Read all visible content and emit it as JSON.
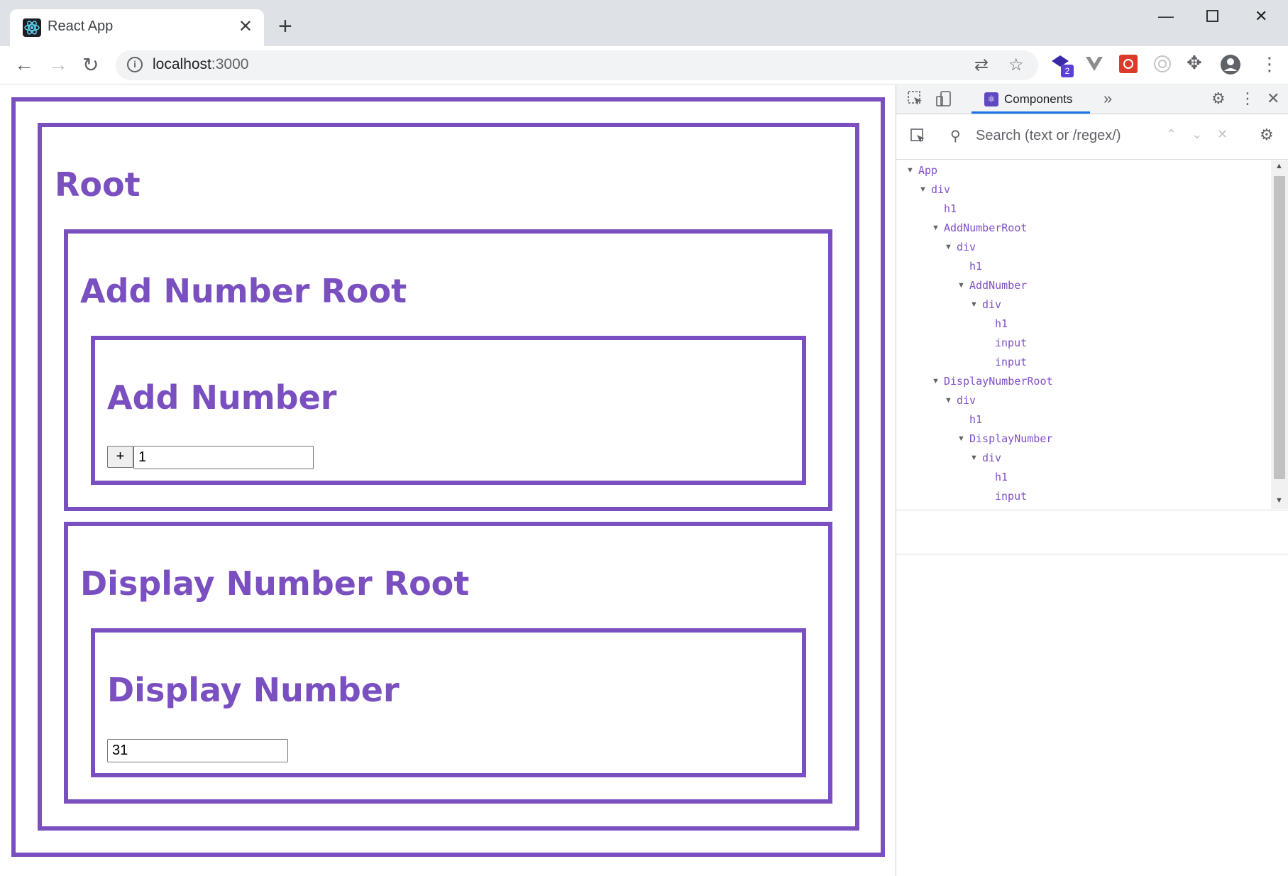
{
  "browser": {
    "tab_title": "React App",
    "url_host": "localhost",
    "url_port": ":3000",
    "extension_badge": "2"
  },
  "page": {
    "root_heading": "Root",
    "add_number_root_heading": "Add Number Root",
    "add_number_heading": "Add Number",
    "plus_label": "+",
    "add_input_value": "1",
    "display_number_root_heading": "Display Number Root",
    "display_number_heading": "Display Number",
    "display_input_value": "31"
  },
  "devtools": {
    "tab_label": "Components",
    "search_placeholder": "Search (text or /regex/)",
    "tree": [
      {
        "label": "App",
        "expanded": true
      },
      {
        "label": "div",
        "expanded": true
      },
      {
        "label": "h1"
      },
      {
        "label": "AddNumberRoot",
        "expanded": true
      },
      {
        "label": "div",
        "expanded": true
      },
      {
        "label": "h1"
      },
      {
        "label": "AddNumber",
        "expanded": true
      },
      {
        "label": "div",
        "expanded": true
      },
      {
        "label": "h1"
      },
      {
        "label": "input"
      },
      {
        "label": "input"
      },
      {
        "label": "DisplayNumberRoot",
        "expanded": true
      },
      {
        "label": "div",
        "expanded": true
      },
      {
        "label": "h1"
      },
      {
        "label": "DisplayNumber",
        "expanded": true
      },
      {
        "label": "div",
        "expanded": true
      },
      {
        "label": "h1"
      },
      {
        "label": "input"
      }
    ]
  },
  "colors": {
    "accent": "#7a4fc0",
    "tree_text": "#8150c8",
    "devtools_tab_underline": "#1a73e8"
  }
}
